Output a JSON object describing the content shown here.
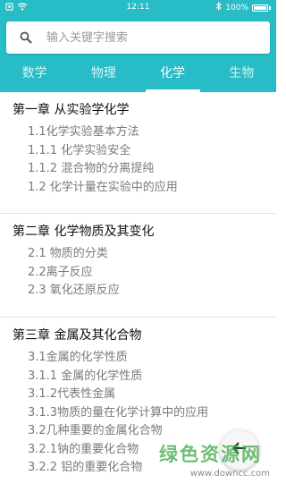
{
  "status_bar": {
    "time": "12:11",
    "battery": "100%"
  },
  "search": {
    "placeholder": "输入关键字搜索"
  },
  "tabs": [
    {
      "label": "数学",
      "active": false
    },
    {
      "label": "物理",
      "active": false
    },
    {
      "label": "化学",
      "active": true
    },
    {
      "label": "生物",
      "active": false
    }
  ],
  "chapters": [
    {
      "title": "第一章 从实验学化学",
      "sections": [
        "1.1化学实验基本方法",
        "1.1.1 化学实验安全",
        "1.1.2 混合物的分离提纯",
        "1.2 化学计量在实验中的应用"
      ]
    },
    {
      "title": "第二章 化学物质及其变化",
      "sections": [
        "2.1 物质的分类",
        "2.2离子反应",
        "2.3 氧化还原反应"
      ]
    },
    {
      "title": "第三章 金属及其化合物",
      "sections": [
        "3.1金属的化学性质",
        "3.1.1 金属的化学性质",
        "3.1.2代表性金属",
        "3.1.3物质的量在化学计算中的应用",
        "3.2几种重要的金属化合物",
        "3.2.1钠的重要化合物",
        "3.2.2 铝的重要化合物"
      ]
    }
  ],
  "watermark": {
    "main": "绿色资源网",
    "sub": "www.downcc.com"
  },
  "colors": {
    "accent": "#27bcc6",
    "watermark_green": "#3ea948"
  },
  "icons": {
    "search": "search-icon",
    "back": "back-arrow-icon",
    "wifi": "wifi-icon",
    "bluetooth": "bluetooth-icon",
    "battery": "battery-icon"
  }
}
